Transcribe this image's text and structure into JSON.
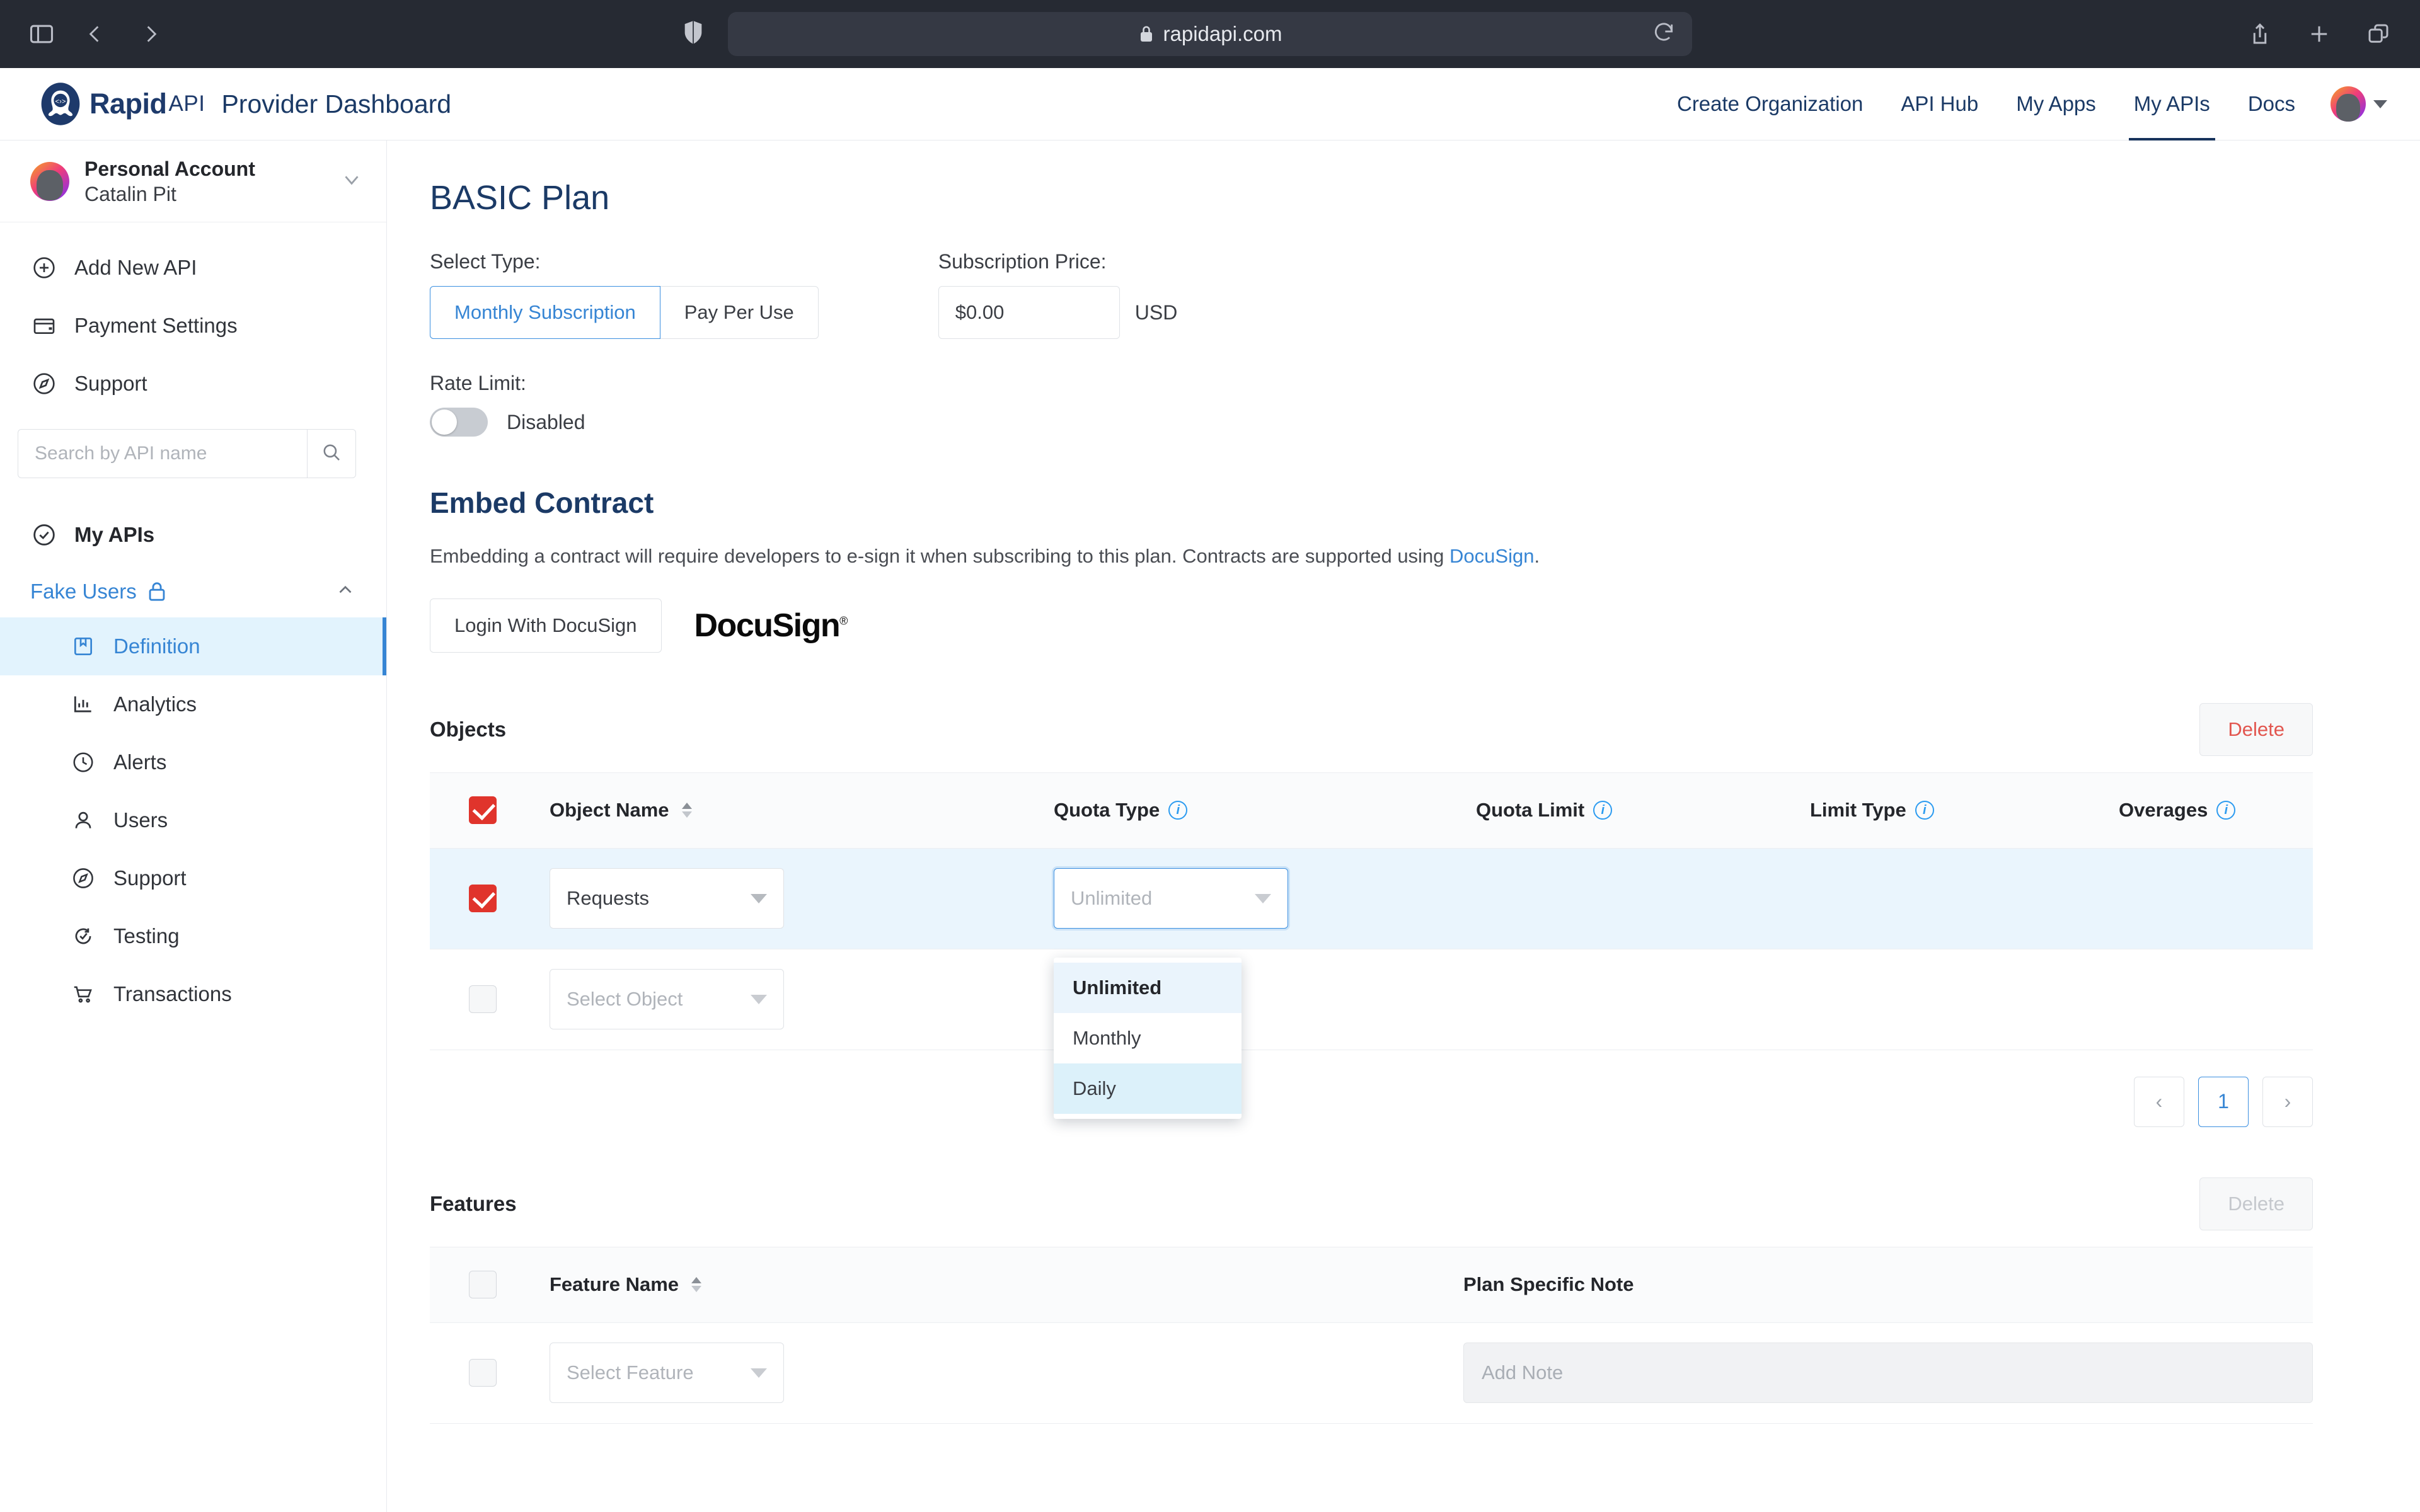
{
  "browser": {
    "url": "rapidapi.com",
    "icons": {
      "sidebar_toggle": "sidebar-toggle-icon",
      "back": "back-arrow-icon",
      "forward": "forward-arrow-icon",
      "shield": "shield-icon",
      "lock": "lock-icon",
      "reload": "reload-icon",
      "share": "share-icon",
      "new_tab": "plus-icon",
      "tabs": "tabs-icon"
    }
  },
  "header": {
    "brand_rapid": "Rapid",
    "brand_api": "API",
    "brand_dashboard": "Provider Dashboard",
    "nav": [
      {
        "label": "Create Organization",
        "active": false
      },
      {
        "label": "API Hub",
        "active": false
      },
      {
        "label": "My Apps",
        "active": false
      },
      {
        "label": "My APIs",
        "active": true
      },
      {
        "label": "Docs",
        "active": false
      }
    ]
  },
  "sidebar": {
    "account": {
      "type": "Personal Account",
      "name": "Catalin Pit"
    },
    "nav": [
      {
        "label": "Add New API",
        "icon": "plus-circle-icon"
      },
      {
        "label": "Payment Settings",
        "icon": "credit-card-icon"
      },
      {
        "label": "Support",
        "icon": "compass-icon"
      }
    ],
    "search": {
      "placeholder": "Search by API name",
      "value": ""
    },
    "my_apis_label": "My APIs",
    "api_group": {
      "name": "Fake Users",
      "locked": true,
      "expanded": true
    },
    "sub_nav": [
      {
        "label": "Definition",
        "icon": "book-icon",
        "active": true
      },
      {
        "label": "Analytics",
        "icon": "bar-chart-icon",
        "active": false
      },
      {
        "label": "Alerts",
        "icon": "clock-icon",
        "active": false
      },
      {
        "label": "Users",
        "icon": "user-icon",
        "active": false
      },
      {
        "label": "Support",
        "icon": "compass-icon",
        "active": false
      },
      {
        "label": "Testing",
        "icon": "refresh-check-icon",
        "active": false
      },
      {
        "label": "Transactions",
        "icon": "cart-icon",
        "active": false
      }
    ]
  },
  "main": {
    "title": "BASIC Plan",
    "select_type": {
      "label": "Select Type:",
      "options": [
        "Monthly Subscription",
        "Pay Per Use"
      ],
      "selected": "Monthly Subscription"
    },
    "subscription_price": {
      "label": "Subscription Price:",
      "value": "$0.00",
      "currency": "USD"
    },
    "rate_limit": {
      "label": "Rate Limit:",
      "state": "Disabled",
      "enabled": false
    },
    "embed_contract": {
      "title": "Embed Contract",
      "para_before": "Embedding a contract will require developers to e-sign it when subscribing to this plan. Contracts are supported using ",
      "link_text": "DocuSign",
      "para_after": ".",
      "login_button": "Login With DocuSign",
      "logo_text": "DocuSign"
    },
    "objects_table": {
      "caption": "Objects",
      "delete_label": "Delete",
      "delete_enabled": true,
      "columns": [
        {
          "label": "Object Name",
          "sortable": true,
          "info": false
        },
        {
          "label": "Quota Type",
          "sortable": false,
          "info": true
        },
        {
          "label": "Quota Limit",
          "sortable": false,
          "info": true
        },
        {
          "label": "Limit Type",
          "sortable": false,
          "info": true
        },
        {
          "label": "Overages",
          "sortable": false,
          "info": true
        }
      ],
      "header_checked": true,
      "rows": [
        {
          "checked": true,
          "object_name": "Requests",
          "object_name_is_placeholder": false,
          "quota_type": "Unlimited",
          "quota_type_is_placeholder": true,
          "quota_limit": "",
          "limit_type": "",
          "overages": ""
        },
        {
          "checked": false,
          "object_name": "Select Object",
          "object_name_is_placeholder": true,
          "quota_type": "",
          "quota_type_is_placeholder": true,
          "quota_limit": "",
          "limit_type": "",
          "overages": ""
        }
      ],
      "quota_type_dropdown": {
        "open": true,
        "options": [
          {
            "label": "Unlimited",
            "selected": true,
            "hover": false
          },
          {
            "label": "Monthly",
            "selected": false,
            "hover": false
          },
          {
            "label": "Daily",
            "selected": false,
            "hover": true
          }
        ]
      },
      "pagination": {
        "prev": "‹",
        "next": "›",
        "pages": [
          "1"
        ],
        "current": "1"
      }
    },
    "features_table": {
      "caption": "Features",
      "delete_label": "Delete",
      "delete_enabled": false,
      "columns": [
        {
          "label": "Feature Name",
          "sortable": true
        },
        {
          "label": "Plan Specific Note",
          "sortable": false
        }
      ],
      "header_checked": false,
      "rows": [
        {
          "checked": false,
          "feature_name": "Select Feature",
          "note_placeholder": "Add Note",
          "note_value": ""
        }
      ]
    }
  },
  "colors": {
    "brand_navy": "#1b3a66",
    "accent_blue": "#3685d4",
    "danger_red": "#e0342c",
    "delete_text": "#e2564f",
    "row_selected": "#eaf5fd",
    "dropdown_hover": "#dcf1fa"
  }
}
